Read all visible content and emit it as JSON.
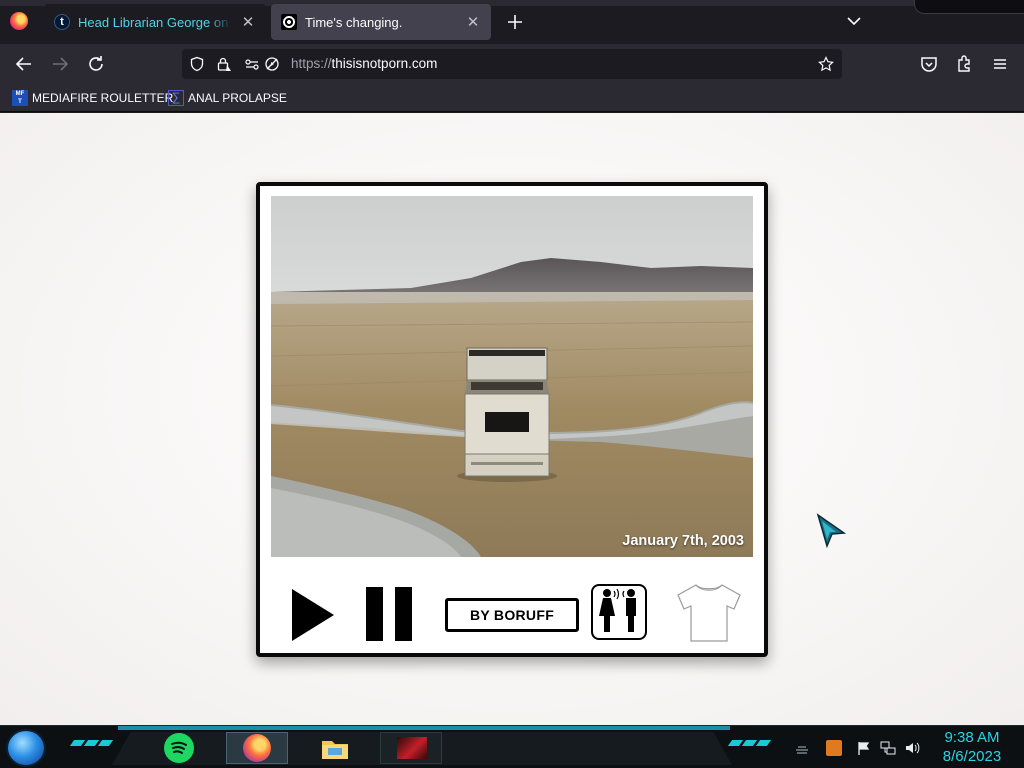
{
  "browser": {
    "tabs": [
      {
        "title": "Head Librarian George on Tumblr",
        "favicon": "tumblr-icon",
        "active": false
      },
      {
        "title": "Time's changing.",
        "favicon": "spiral-icon",
        "active": true
      }
    ],
    "url_scheme": "https://",
    "url_host": "thisisnotporn.com",
    "bookmarks": [
      {
        "label": "MEDIAFIRE ROULETTER",
        "icon": "mediafire-icon"
      },
      {
        "label": "ANAL PROLAPSE",
        "icon": "sigma-icon"
      }
    ]
  },
  "page": {
    "photo_date": "January 7th, 2003",
    "byline": "BY BORUFF",
    "controls": [
      "play-icon",
      "pause-icon",
      "byline-button",
      "share-people-icon",
      "tshirt-icon"
    ]
  },
  "taskbar": {
    "time": "9:38 AM",
    "date": "8/6/2023",
    "apps": [
      "spotify-icon",
      "firefox-icon",
      "file-explorer-icon",
      "game-window-thumbnail"
    ]
  },
  "colors": {
    "accent_cyan": "#29d3e0",
    "tab_active_bg": "#42414d",
    "toolbar_bg": "#2b2a33",
    "frame_border": "#0a0a0a"
  }
}
